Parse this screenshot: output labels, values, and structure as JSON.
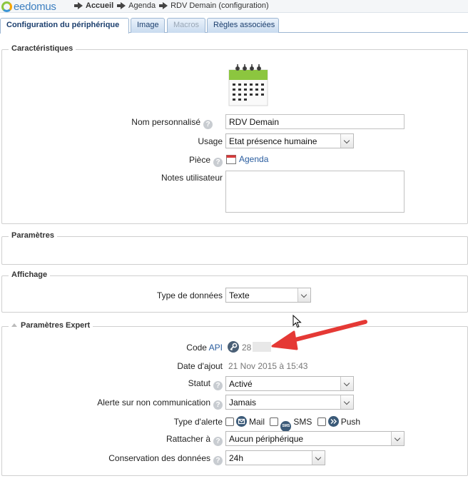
{
  "app": {
    "logo_text": "eedomus"
  },
  "breadcrumb": [
    {
      "label": "Accueil",
      "bold": true
    },
    {
      "label": "Agenda",
      "bold": false
    },
    {
      "label": "RDV Demain (configuration)",
      "bold": false
    }
  ],
  "tabs": [
    {
      "label": "Configuration du périphérique",
      "state": "active"
    },
    {
      "label": "Image",
      "state": "normal"
    },
    {
      "label": "Macros",
      "state": "disabled"
    },
    {
      "label": "Règles associées",
      "state": "normal"
    }
  ],
  "caracteristiques": {
    "legend": "Caractéristiques",
    "nom_label": "Nom personnalisé",
    "nom_value": "RDV Demain",
    "usage_label": "Usage",
    "usage_value": "Etat présence humaine",
    "piece_label": "Pièce",
    "piece_value": "Agenda",
    "notes_label": "Notes utilisateur",
    "calendar_icon": "calendar-icon"
  },
  "parametres": {
    "legend": "Paramètres"
  },
  "affichage": {
    "legend": "Affichage",
    "type_label": "Type de données",
    "type_value": "Texte"
  },
  "expert": {
    "legend": "Paramètres Expert",
    "code_label": "Code",
    "code_api_link": "API",
    "code_value": "28",
    "date_label": "Date d'ajout",
    "date_value": "21 Nov 2015 à 15:43",
    "statut_label": "Statut",
    "statut_value": "Activé",
    "alerte_label": "Alerte sur non communication",
    "alerte_value": "Jamais",
    "type_alerte_label": "Type d'alerte",
    "alert_types": [
      "Mail",
      "SMS",
      "Push"
    ],
    "sms_icon_text": "SMS",
    "rattacher_label": "Rattacher à",
    "rattacher_value": "Aucun périphérique",
    "conservation_label": "Conservation des données",
    "conservation_value": "24h"
  },
  "help_glyph": "?",
  "colors": {
    "accent": "#2a5d9f",
    "arrow": "#e53935",
    "tab_border": "#9cb6d2"
  }
}
